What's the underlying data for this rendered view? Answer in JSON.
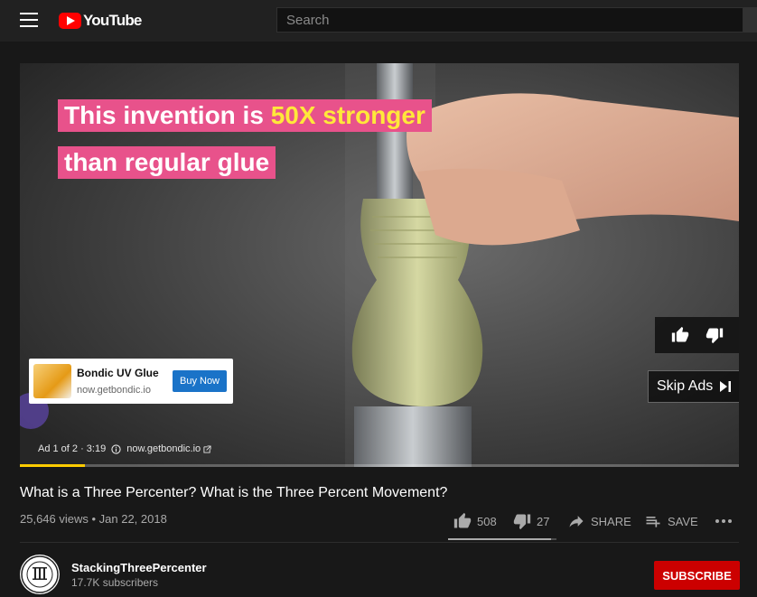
{
  "header": {
    "logo_text": "YouTube",
    "search_placeholder": "Search"
  },
  "player": {
    "overlay_line1_prefix": "This invention is ",
    "overlay_line1_highlight": "50X stronger",
    "overlay_line2": "than regular glue",
    "skip_label": "Skip Ads",
    "ad_card": {
      "name": "Bondic UV Glue",
      "url": "now.getbondic.io",
      "cta": "Buy Now"
    },
    "ad_info": {
      "position": "Ad 1 of 2 · 3:19",
      "domain": "now.getbondic.io"
    },
    "ad_progress_fraction": 0.09
  },
  "video": {
    "title": "What is a Three Percenter? What is the Three Percent Movement?",
    "views_date": "25,646 views • Jan 22, 2018",
    "likes": "508",
    "dislikes": "27",
    "share_label": "SHARE",
    "save_label": "SAVE",
    "like_ratio": 0.95
  },
  "channel": {
    "name": "StackingThreePercenter",
    "subscribers": "17.7K subscribers",
    "subscribe_label": "SUBSCRIBE"
  },
  "colors": {
    "youtube_red": "#ff0000",
    "subscribe_red": "#cc0000",
    "overlay_pink": "#e8528b",
    "overlay_highlight": "#ffe83a",
    "ad_progress": "#ffcc00",
    "buy_button": "#1a73c8"
  },
  "icons": [
    "menu-icon",
    "youtube-play-icon",
    "thumbs-up-icon",
    "thumbs-down-icon",
    "skip-next-icon",
    "info-icon",
    "external-link-icon",
    "share-arrow-icon",
    "playlist-add-icon",
    "more-horizontal-icon"
  ]
}
